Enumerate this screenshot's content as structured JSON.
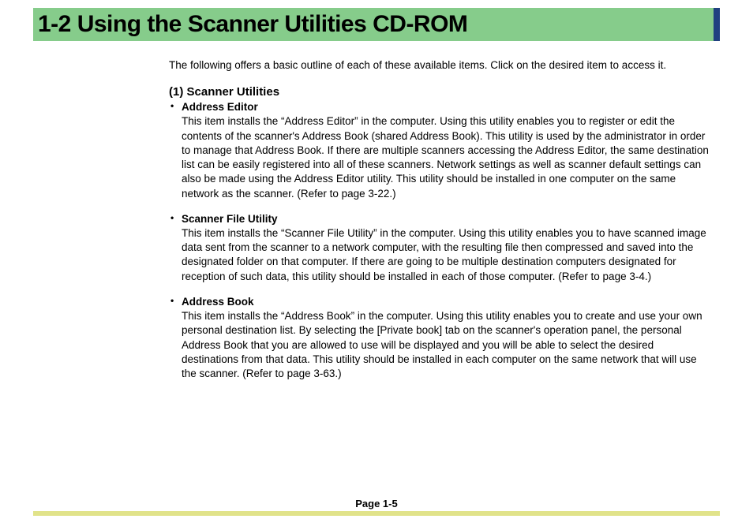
{
  "heading": "1-2  Using the Scanner Utilities CD-ROM",
  "intro": "The following offers a basic outline of each of these available items. Click on the desired item to access it.",
  "section": {
    "title": "(1) Scanner Utilities",
    "items": [
      {
        "name": "Address Editor",
        "body": "This item installs the “Address Editor” in the computer. Using this utility enables you to register or edit the contents of the scanner's Address Book (shared Address Book). This utility is used by the administrator in order to manage that Address Book. If there are multiple scanners accessing the Address Editor, the same destination list can be easily registered into all of these scanners. Network settings as well as scanner default settings can also be made using the Address Editor utility. This utility should be installed in one computer on the same network as the scanner. (Refer to page 3-22.)"
      },
      {
        "name": "Scanner File Utility",
        "body": "This item installs the “Scanner File Utility” in the computer. Using this utility enables you to have scanned image data sent from the scanner to a network computer, with the resulting file then compressed and saved into the designated folder on that computer. If there are going to be multiple destination computers designated for reception of such data, this utility should be installed in each of those computer. (Refer to page 3-4.)"
      },
      {
        "name": "Address Book",
        "body": "This item installs the “Address Book” in the computer. Using this utility enables you to create and use your own personal destination list. By selecting the [Private book] tab on the scanner's operation panel, the personal Address Book that you are allowed to use will be displayed and you will be able to select the desired destinations from that data. This utility should be installed in each computer on the same network that will use the scanner. (Refer to page 3-63.)"
      }
    ]
  },
  "page_label": "Page 1-5"
}
